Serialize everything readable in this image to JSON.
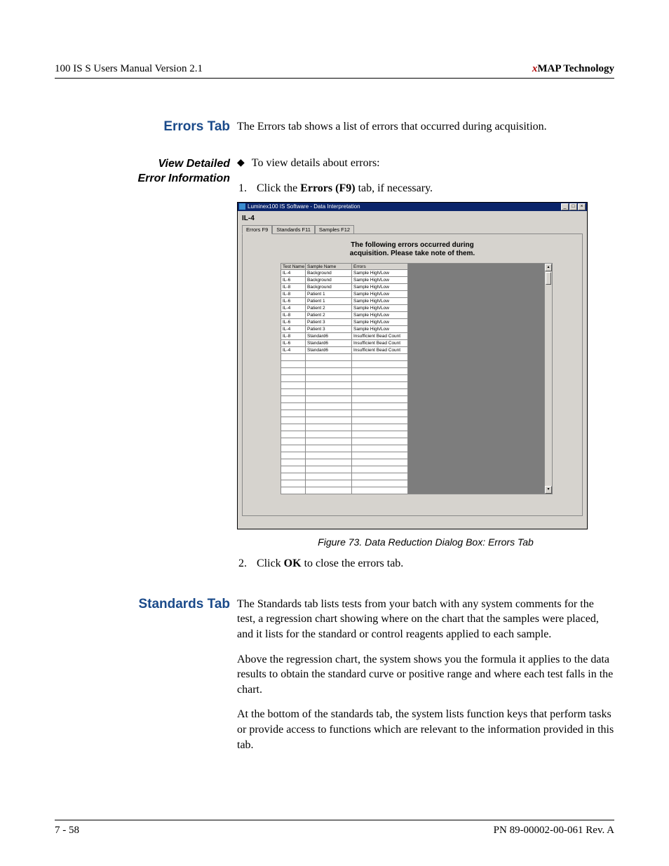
{
  "header": {
    "left": "100 IS S Users Manual Version 2.1",
    "right_x": "x",
    "right_rest": "MAP Technology"
  },
  "errors_section": {
    "heading": "Errors Tab",
    "intro": "The Errors tab shows a list of errors that occurred during acquisition.",
    "side_heading_l1": "View Detailed",
    "side_heading_l2": "Error Information",
    "bullet": "To view details about errors:",
    "step1_num": "1.",
    "step1_a": "Click the ",
    "step1_b": "Errors (F9)",
    "step1_c": " tab, if necessary.",
    "step2_num": "2.",
    "step2_a": "Click ",
    "step2_b": "OK",
    "step2_c": " to close the errors tab.",
    "caption": "Figure 73.  Data Reduction Dialog Box: Errors Tab"
  },
  "window": {
    "title": "Luminex100 IS Software - Data Interpretation",
    "assay": "IL-4",
    "tabs": {
      "errors": "Errors F9",
      "standards": "Standards F11",
      "samples": "Samples F12"
    },
    "heading_l1": "The following errors occurred during",
    "heading_l2": "acquisition.  Please take note of them.",
    "cols": {
      "test": "Test Name",
      "sample": "Sample Name",
      "errors": "Errors"
    },
    "rows": [
      {
        "test": "IL-4",
        "sample": "Background",
        "err": "Sample High/Low"
      },
      {
        "test": "IL-6",
        "sample": "Background",
        "err": "Sample High/Low"
      },
      {
        "test": "IL-8",
        "sample": "Background",
        "err": "Sample High/Low"
      },
      {
        "test": "IL-8",
        "sample": "Patient 1",
        "err": "Sample High/Low"
      },
      {
        "test": "IL-6",
        "sample": "Patient 1",
        "err": "Sample High/Low"
      },
      {
        "test": "IL-4",
        "sample": "Patient 2",
        "err": "Sample High/Low"
      },
      {
        "test": "IL-8",
        "sample": "Patient 2",
        "err": "Sample High/Low"
      },
      {
        "test": "IL-6",
        "sample": "Patient 3",
        "err": "Sample High/Low"
      },
      {
        "test": "IL-4",
        "sample": "Patient 3",
        "err": "Sample High/Low"
      },
      {
        "test": "IL-8",
        "sample": "Standard6",
        "err": "Insufficient Bead Count"
      },
      {
        "test": "IL-6",
        "sample": "Standard6",
        "err": "Insufficient Bead Count"
      },
      {
        "test": "IL-4",
        "sample": "Standard6",
        "err": "Insufficient Bead Count"
      }
    ],
    "empty_row_count": 20
  },
  "standards_section": {
    "heading": "Standards Tab",
    "p1": "The Standards tab lists tests from your batch with any system comments for the test, a regression chart showing where on the chart that the samples were placed, and it lists for the standard or control reagents applied to each sample.",
    "p2": "Above the regression chart, the system shows you the formula it applies to the data results to obtain the standard curve or positive range and where each test falls in the chart.",
    "p3": "At the bottom of the standards tab, the system lists function keys that perform tasks or provide access to functions which are relevant to the information provided in this tab."
  },
  "footer": {
    "left": "7 - 58",
    "right": "PN 89-00002-00-061 Rev. A"
  }
}
